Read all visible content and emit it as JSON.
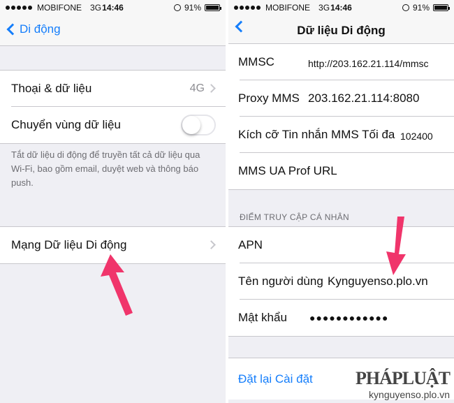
{
  "status_bar": {
    "carrier": "MOBIFONE",
    "network": "3G",
    "time": "14:46",
    "battery": "91%",
    "battery_level": 0.91
  },
  "left": {
    "nav": {
      "back_label": "Di động"
    },
    "rows": [
      {
        "label": "Thoại & dữ liệu",
        "detail": "4G"
      },
      {
        "label": "Chuyển vùng dữ liệu",
        "toggle": false
      }
    ],
    "note": "Tắt dữ liệu di động để truyền tất cả dữ liệu qua Wi-Fi, bao gồm email, duyệt web và thông báo push.",
    "cellular_row": {
      "label": "Mạng Dữ liệu Di động"
    }
  },
  "right": {
    "nav": {
      "title": "Dữ liệu Di động"
    },
    "mms": [
      {
        "label": "MMSC",
        "value": "http://203.162.21.114/mmsc"
      },
      {
        "label": "Proxy MMS",
        "value": "203.162.21.114:8080"
      },
      {
        "label": "Kích cỡ Tin nhắn MMS Tối đa",
        "value": "102400"
      },
      {
        "label": "MMS UA Prof URL",
        "value": ""
      }
    ],
    "section_header": "ĐIỂM TRUY CẬP CÁ NHÂN",
    "hotspot": [
      {
        "label": "APN",
        "value": ""
      },
      {
        "label": "Tên người dùng",
        "value": "Kynguyenso.plo.vn"
      },
      {
        "label": "Mật khẩu",
        "value": "●●●●●●●●●●●●"
      }
    ],
    "reset_label": "Đặt lại Cài đặt"
  },
  "watermark": {
    "brand": "PHÁPLUẬT",
    "site": "kynguyenso.plo.vn"
  },
  "colors": {
    "accent": "#157efb",
    "arrow": "#f0356b"
  },
  "icons": [
    "back-chevron-icon",
    "chevron-right-icon",
    "rotation-lock-icon",
    "battery-icon",
    "pointer-arrow-icon"
  ]
}
